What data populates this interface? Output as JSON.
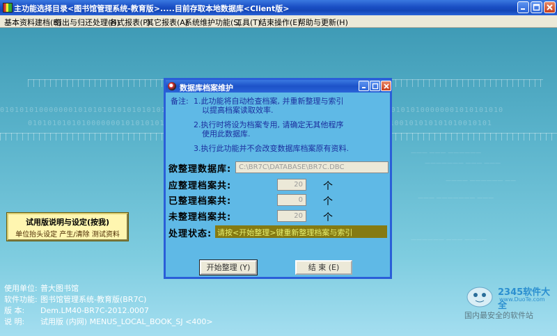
{
  "window": {
    "title": "主功能选择目录<图书馆管理系统-教育版>.....目前存取本地数据库<Client版>"
  },
  "menu": [
    "基本资料建档(B)",
    "借出与归还处理(H)",
    "各式报表(P)",
    "其它报表(A)",
    "系统维护功能(S)",
    "工具(T)",
    "结束操作(E)",
    "帮助与更新(H)"
  ],
  "trial_box": {
    "title": "试用版说明与设定(按我)",
    "subtitle": "单位抬头设定 产生/清除 测试资料"
  },
  "status": {
    "unit_label": "使用单位:",
    "unit_value": "普大图书馆",
    "function_label": "软件功能:",
    "function_value": "图书馆管理系统-教育版(BR7C)",
    "version_label": "版 本:",
    "version_value": "Dem.LM40-BR7C-2012.0007",
    "desc_label": "说 明:",
    "desc_value": "试用版 (内网) MENUS_LOCAL_BOOK_SJ <400>"
  },
  "watermark": {
    "logo": "2345软件大全",
    "site": "www.DuoTe.com",
    "caption": "国内最安全的软件站"
  },
  "dialog": {
    "title": "数据库档案维护",
    "note_label": "备注:",
    "notes": [
      "1.此功能将自动检查档案, 并重新整理与索引",
      "以提高档案读取效率.",
      "2.执行时将设为档案专用, 请确定无其他程序",
      "使用此数据库.",
      "3.执行此功能并不会改变数据库档案原有资料."
    ],
    "db_label": "欲整理数据库:",
    "db_value": "C:\\BR7C\\DATABASE\\BR7C.DBC",
    "should_label": "应整理档案共:",
    "should_value": "20",
    "done_label": "已整理档案共:",
    "done_value": "0",
    "pending_label": "未整理档案共:",
    "pending_value": "20",
    "unit": "个",
    "status_label": "处理状态:",
    "status_value": "请按<开始整理>键重新整理档案与索引",
    "start_button": "开始整理 (Y)",
    "end_button": "结 束 (E)"
  },
  "colors": {
    "titlebar": "#1a4fc4",
    "dialog_bg": "#5fb9e6",
    "status_field_bg": "#857a12"
  }
}
